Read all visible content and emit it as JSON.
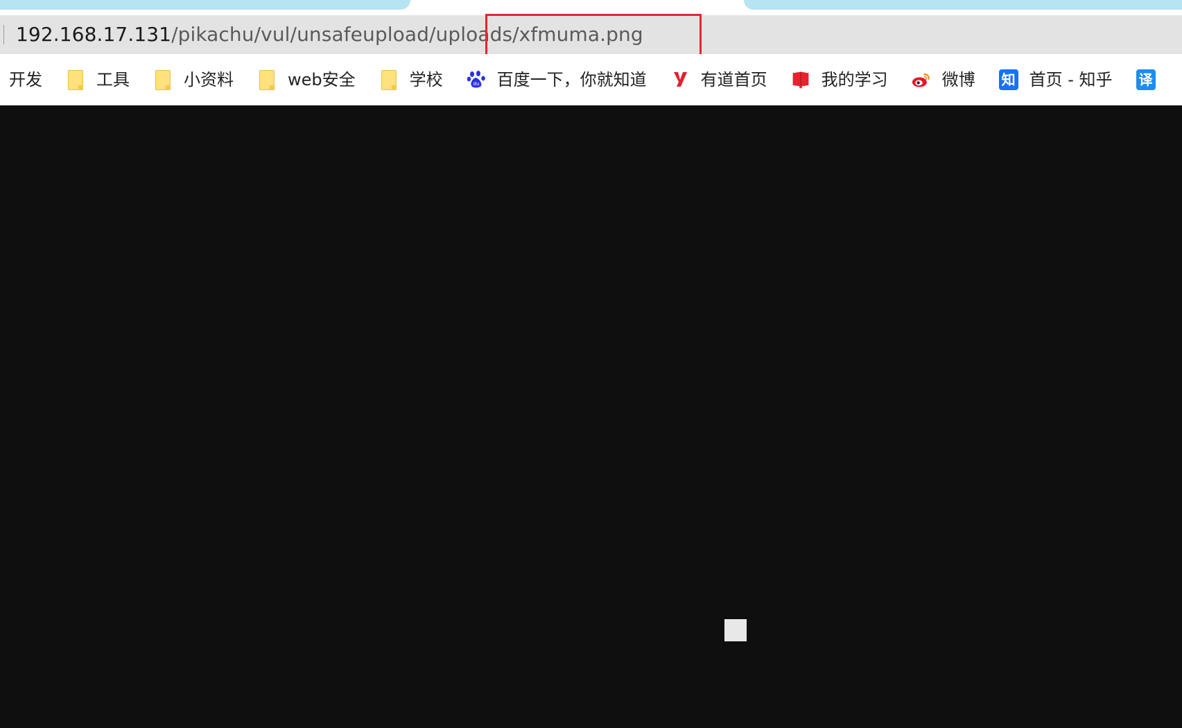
{
  "address_bar": {
    "url_host": "192.168.17.131",
    "url_path": "/pikachu/vul/unsafeupload/uploads/xfmuma.png"
  },
  "bookmarks": [
    {
      "label": "开发",
      "icon": "none"
    },
    {
      "label": "工具",
      "icon": "folder-icon"
    },
    {
      "label": "小资料",
      "icon": "folder-icon"
    },
    {
      "label": "web安全",
      "icon": "folder-icon"
    },
    {
      "label": "学校",
      "icon": "folder-icon"
    },
    {
      "label": "百度一下，你就知道",
      "icon": "baidu-paw-icon"
    },
    {
      "label": "有道首页",
      "icon": "youdao-y-icon"
    },
    {
      "label": "我的学习",
      "icon": "red-book-icon"
    },
    {
      "label": "微博",
      "icon": "weibo-icon"
    },
    {
      "label": "首页 - 知乎",
      "icon": "zhihu-icon",
      "icon_text": "知"
    },
    {
      "label": "",
      "icon": "translate-icon",
      "icon_text": "译"
    }
  ],
  "colors": {
    "tab_inactive": "#b6e4f2",
    "address_bg": "#e3e3e3",
    "highlight": "#e5252f",
    "page_bg": "#0f0f0f",
    "zhihu_blue": "#1772f6",
    "youdao_red": "#e0202e"
  }
}
